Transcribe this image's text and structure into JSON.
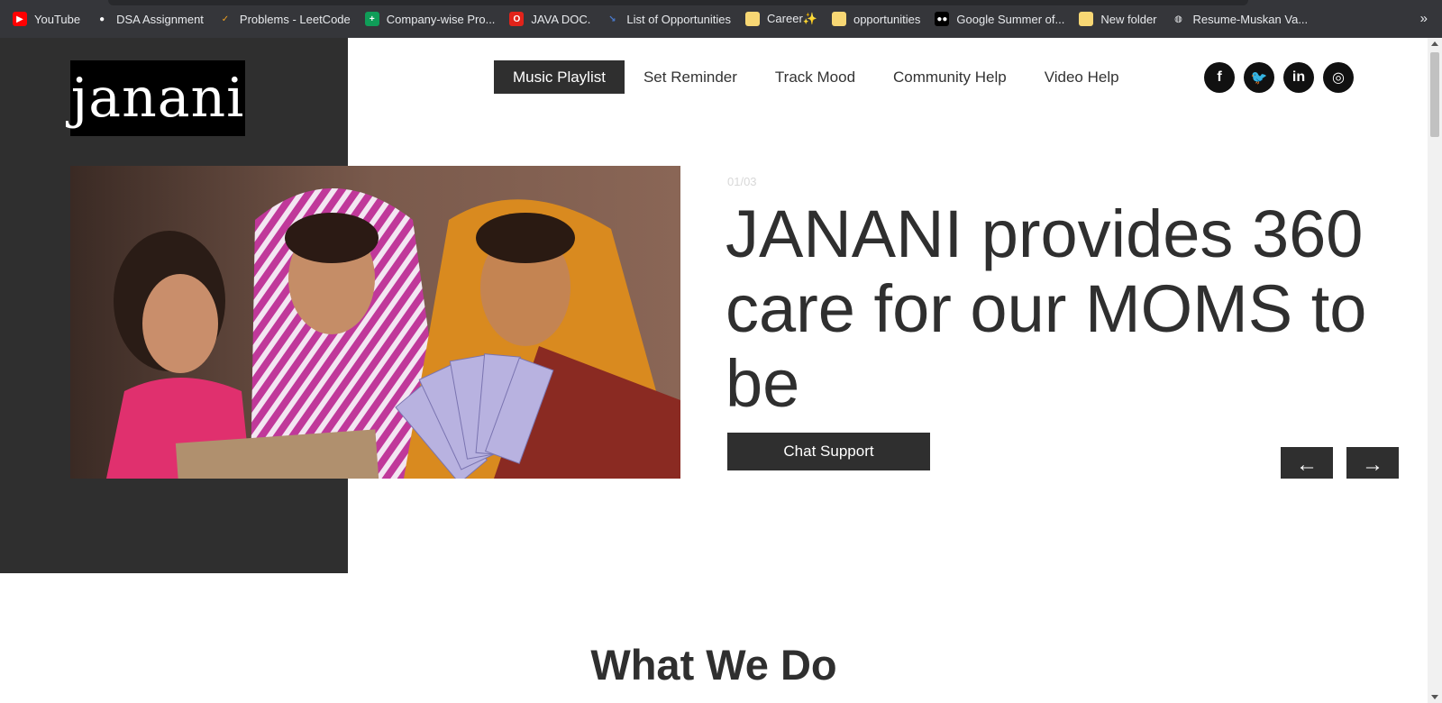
{
  "bookmarks": [
    {
      "label": "YouTube",
      "icon": "youtube-icon",
      "color": "#ff0000",
      "glyph": "▶"
    },
    {
      "label": "DSA Assignment",
      "icon": "github-icon",
      "color": "#ffffff",
      "glyph": "●"
    },
    {
      "label": "Problems - LeetCode",
      "icon": "leetcode-icon",
      "color": "#f0a020",
      "glyph": "✓"
    },
    {
      "label": "Company-wise Pro...",
      "icon": "sheets-icon",
      "color": "#0f9d58",
      "glyph": "+"
    },
    {
      "label": "JAVA DOC.",
      "icon": "oracle-icon",
      "color": "#e2231a",
      "glyph": "O"
    },
    {
      "label": "List of Opportunities",
      "icon": "link-icon",
      "color": "#4a7bd0",
      "glyph": "↘"
    },
    {
      "label": "Career✨",
      "icon": "folder-icon",
      "color": "#f7d774",
      "glyph": ""
    },
    {
      "label": "opportunities",
      "icon": "folder-icon",
      "color": "#f7d774",
      "glyph": ""
    },
    {
      "label": "Google Summer of...",
      "icon": "medium-icon",
      "color": "#000000",
      "glyph": "●●"
    },
    {
      "label": "New folder",
      "icon": "folder-icon",
      "color": "#f7d774",
      "glyph": ""
    },
    {
      "label": "Resume-Muskan Va...",
      "icon": "globe-icon",
      "color": "#e8eaed",
      "glyph": "◍"
    }
  ],
  "bookmarks_more": "»",
  "logo": {
    "text": "janani"
  },
  "nav": {
    "items": [
      {
        "label": "Music Playlist",
        "active": true
      },
      {
        "label": "Set Reminder"
      },
      {
        "label": "Track Mood"
      },
      {
        "label": "Community Help"
      },
      {
        "label": "Video Help"
      }
    ]
  },
  "social": [
    {
      "name": "facebook-icon",
      "glyph": "f"
    },
    {
      "name": "twitter-icon",
      "glyph": "🐦"
    },
    {
      "name": "linkedin-icon",
      "glyph": "in"
    },
    {
      "name": "instagram-icon",
      "glyph": "◎"
    }
  ],
  "hero": {
    "counter": "01/03",
    "headline": "JANANI provides 360 care for our MOMS to be",
    "cta": "Chat Support",
    "prev": "←",
    "next": "→"
  },
  "section": {
    "title": "What We Do"
  },
  "colors": {
    "dark": "#2f2f2f",
    "chrome_bar": "#35363a"
  }
}
